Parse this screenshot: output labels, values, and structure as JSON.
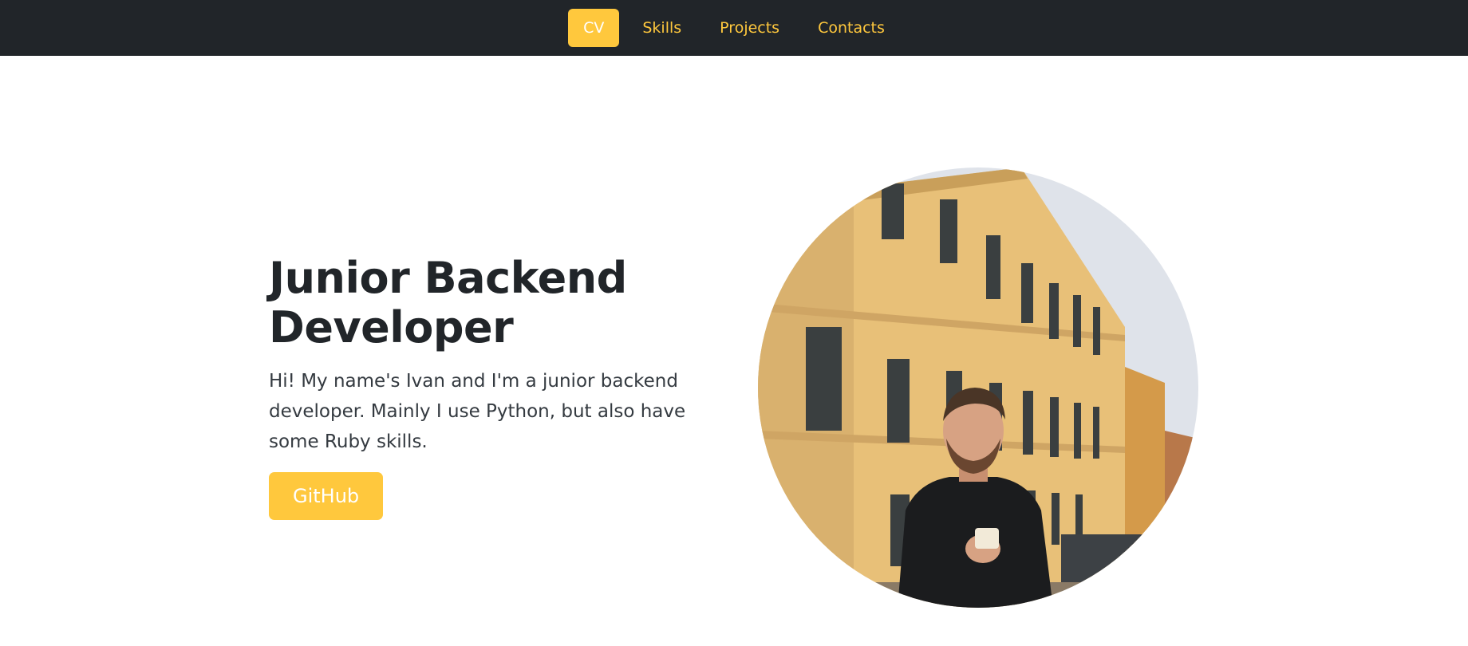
{
  "nav": {
    "items": [
      {
        "label": "CV",
        "active": true
      },
      {
        "label": "Skills",
        "active": false
      },
      {
        "label": "Projects",
        "active": false
      },
      {
        "label": "Contacts",
        "active": false
      }
    ]
  },
  "hero": {
    "title_line1": "Junior Backend",
    "title_line2": "Developer",
    "lead": "Hi! My name's Ivan and I'm a junior backend developer. Mainly I use Python, but also have some Ruby skills.",
    "github_label": "GitHub"
  },
  "colors": {
    "navbar_bg": "#212529",
    "accent": "#ffc83d",
    "text_dark": "#212529"
  }
}
